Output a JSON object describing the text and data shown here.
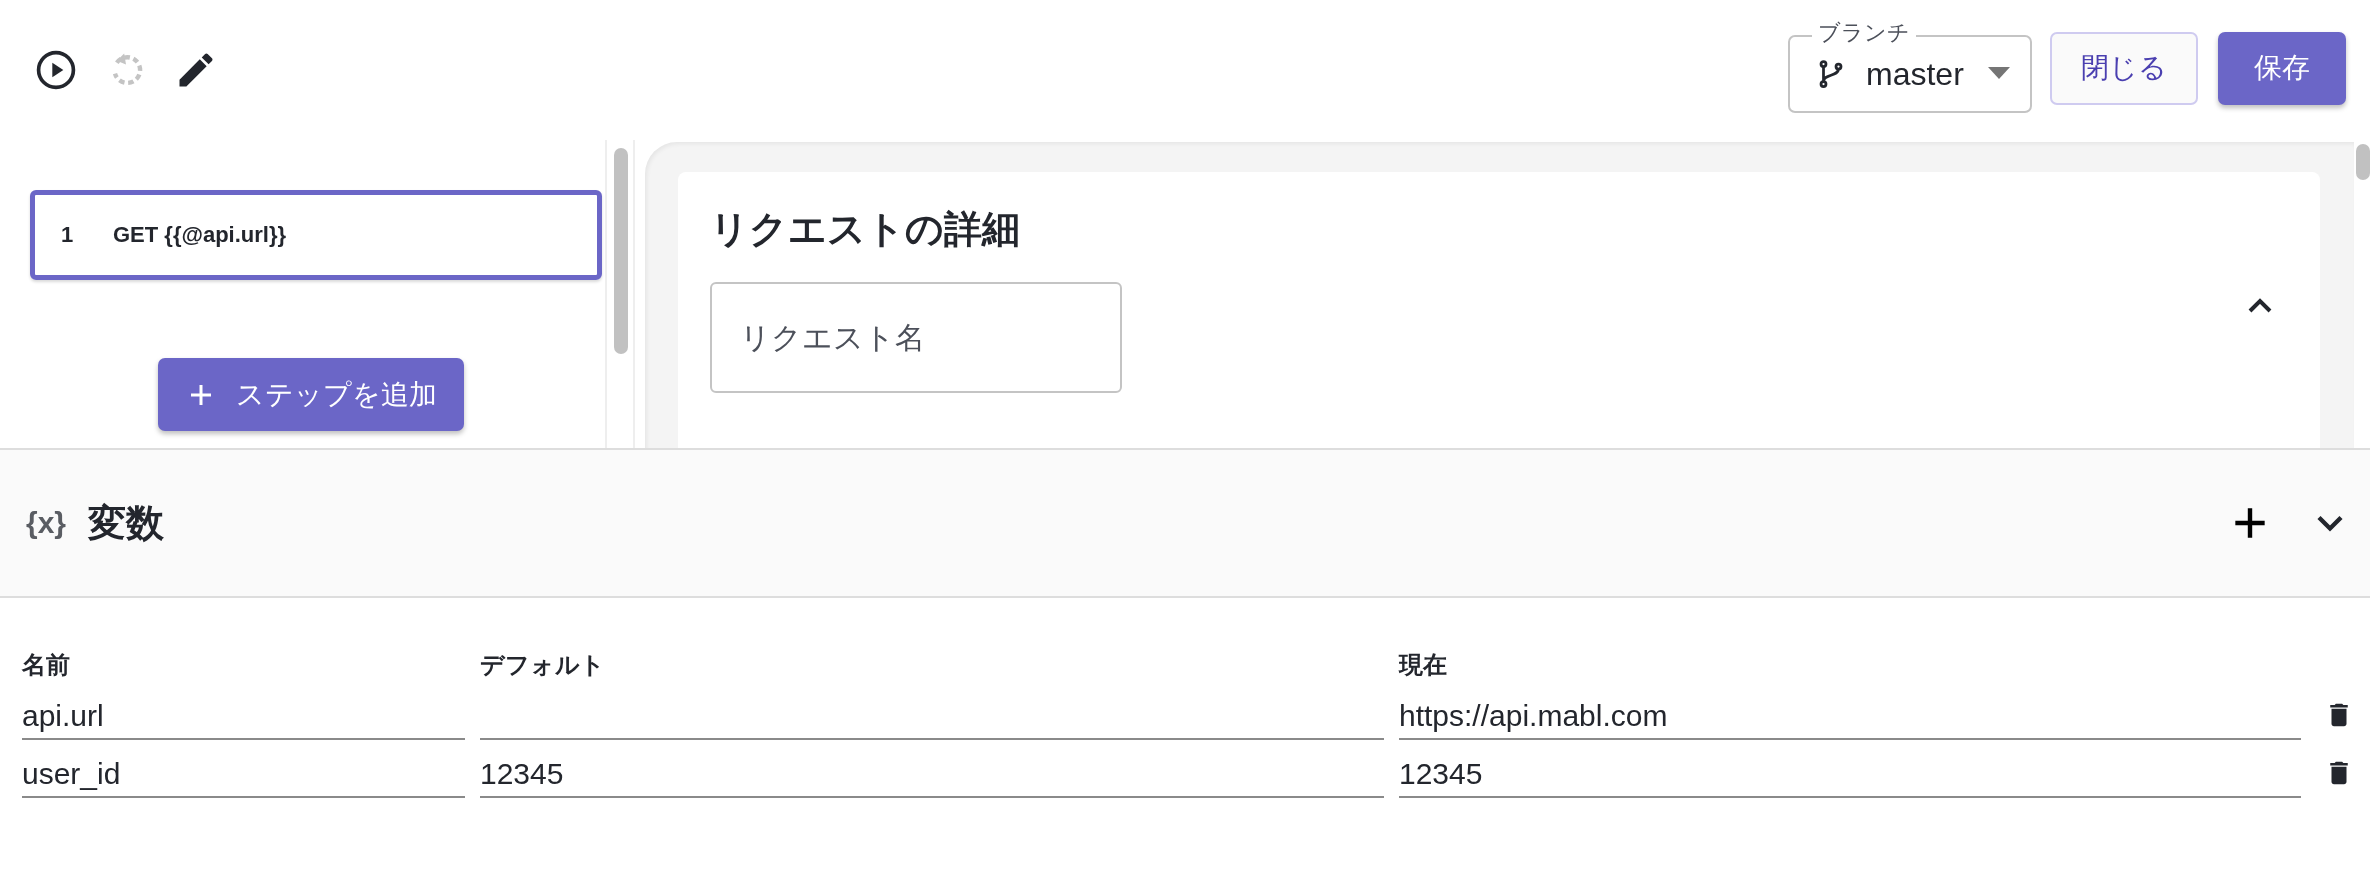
{
  "toolbar": {
    "buttons": [
      {
        "kind": "run",
        "disabled": false
      },
      {
        "kind": "reset",
        "disabled": true
      },
      {
        "kind": "edit",
        "disabled": false
      }
    ]
  },
  "branch": {
    "label": "ブランチ",
    "value": "master"
  },
  "close_button": "閉じる",
  "save_button": "保存",
  "steps": [
    {
      "number": "1",
      "label": "GET {{@api.url}}",
      "selected": true
    }
  ],
  "add_step_button": "ステップを追加",
  "request_details": {
    "title": "リクエストの詳細",
    "expanded": true,
    "name_field": {
      "placeholder": "リクエスト名"
    }
  },
  "variables": {
    "icon_text": "{x}",
    "title": "変数",
    "columns": [
      "名前",
      "デフォルト",
      "現在"
    ],
    "rows": [
      {
        "name": "api.url",
        "current": "https://api.mabl.com"
      },
      {
        "name": "user_id",
        "default": "12345",
        "current": "12345"
      }
    ]
  }
}
